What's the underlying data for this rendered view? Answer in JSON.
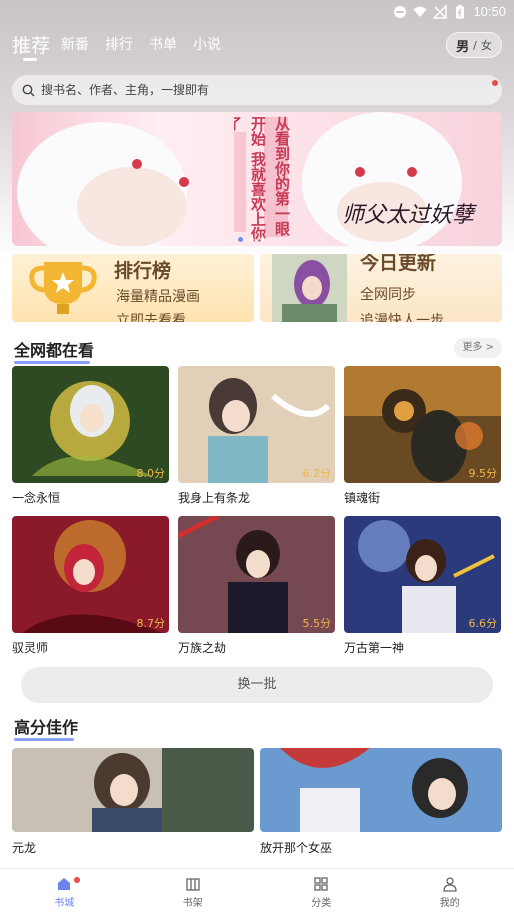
{
  "status_bar": {
    "time": "10:50"
  },
  "top_nav": {
    "tabs": [
      {
        "label": "推荐",
        "active": true
      },
      {
        "label": "新番"
      },
      {
        "label": "排行"
      },
      {
        "label": "书单"
      },
      {
        "label": "小说"
      }
    ],
    "gender": {
      "male": "男",
      "sep": "/",
      "female": "女"
    }
  },
  "search": {
    "placeholder": "搜书名、作者、主角，一搜即有"
  },
  "banner": {
    "text_left": "从看到你的第一眼开始 我就喜欢上你了",
    "text_right": "师父太过妖孽"
  },
  "promos": [
    {
      "title": "排行榜",
      "line1": "海量精品漫画",
      "line2": "立即去看看"
    },
    {
      "title": "今日更新",
      "line1": "全网同步",
      "line2": "追漫快人一步"
    }
  ],
  "section_hot": {
    "title": "全网都在看",
    "more": "更多 >"
  },
  "hot_comics": [
    {
      "name": "一念永恒",
      "score": "8.0分",
      "color": "#3a5a2a"
    },
    {
      "name": "我身上有条龙",
      "score": "6.2分",
      "color": "#9fb7c9"
    },
    {
      "name": "镇魂街",
      "score": "9.5分",
      "color": "#8a5a2a"
    },
    {
      "name": "驭灵师",
      "score": "8.7分",
      "color": "#9a2a3a"
    },
    {
      "name": "万族之劫",
      "score": "5.5分",
      "color": "#7a2a2a"
    },
    {
      "name": "万古第一神",
      "score": "6.6分",
      "color": "#3a4a8a"
    }
  ],
  "refresh": {
    "label": "换一批"
  },
  "section_top": {
    "title": "高分佳作"
  },
  "top_comics": [
    {
      "name": "元龙",
      "color": "#5a6a5a"
    },
    {
      "name": "放开那个女巫",
      "color": "#4a7ab0"
    }
  ],
  "bottom_nav": [
    {
      "label": "书城",
      "active": true
    },
    {
      "label": "书架"
    },
    {
      "label": "分类"
    },
    {
      "label": "我的"
    }
  ],
  "colors": {
    "accent": "#6d84f0",
    "score": "#f0b64a",
    "badge": "#e54b4b"
  }
}
